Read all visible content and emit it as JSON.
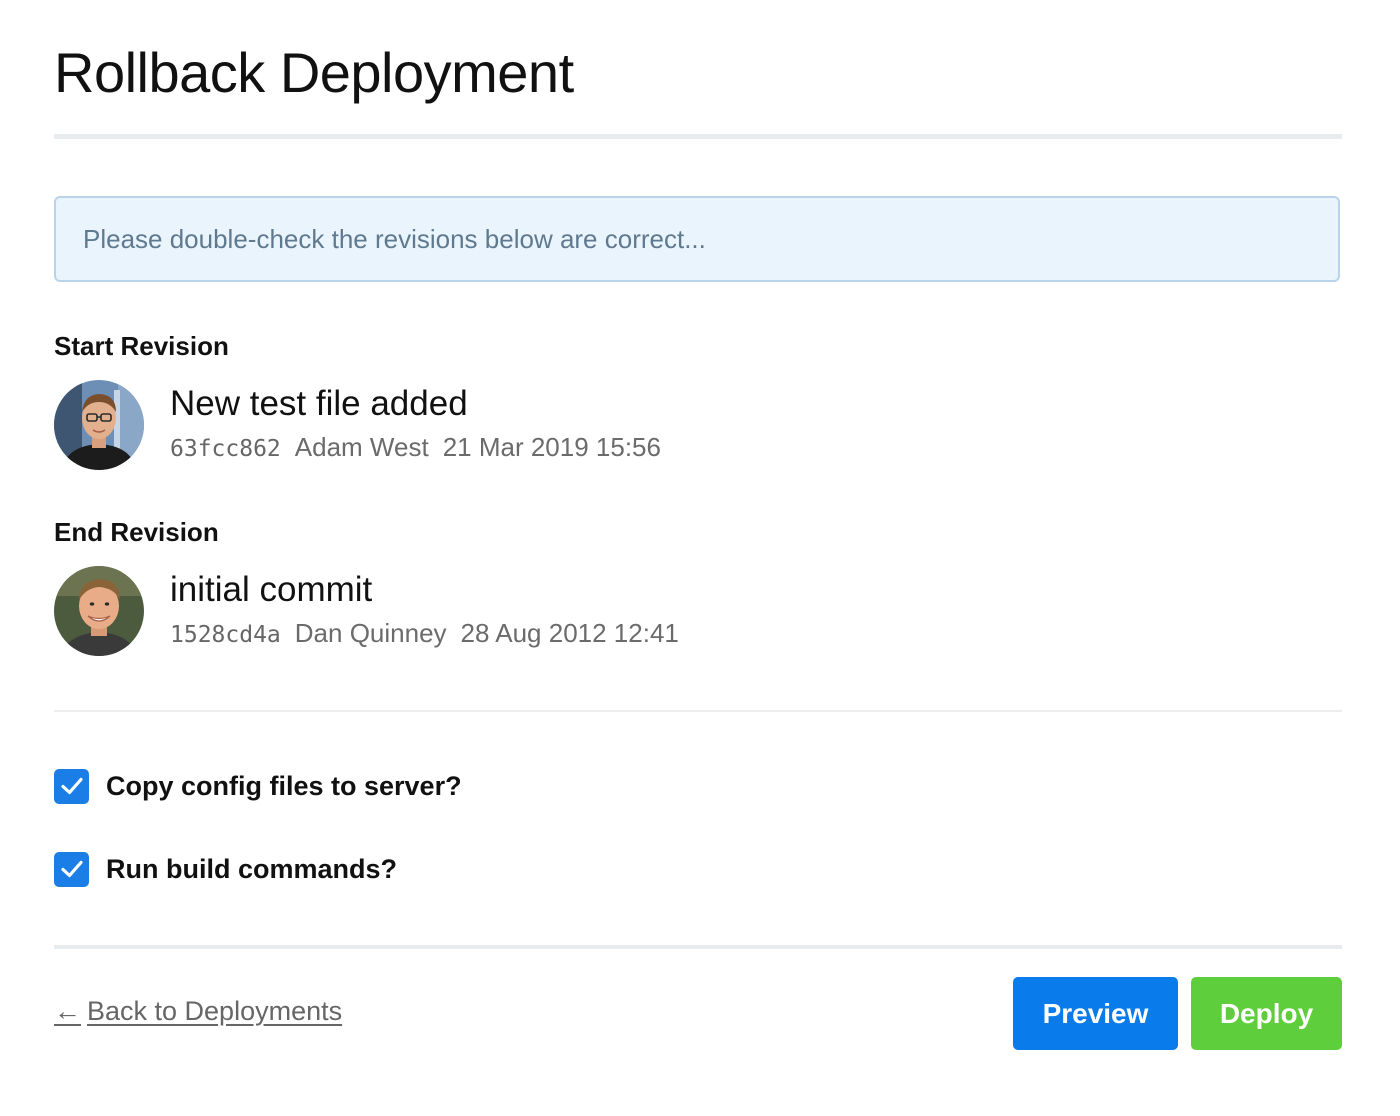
{
  "page": {
    "title": "Rollback Deployment"
  },
  "notice": {
    "text": "Please double-check the revisions below are correct..."
  },
  "start_revision": {
    "label": "Start Revision",
    "message": "New test file added",
    "hash": "63fcc862",
    "author": "Adam West",
    "date": "21 Mar 2019 15:56",
    "avatar_icon": "user-avatar-glasses"
  },
  "end_revision": {
    "label": "End Revision",
    "message": "initial commit",
    "hash": "1528cd4a",
    "author": "Dan Quinney",
    "date": "28 Aug 2012 12:41",
    "avatar_icon": "user-avatar"
  },
  "options": [
    {
      "label": "Copy config files to server?",
      "checked": true
    },
    {
      "label": "Run build commands?",
      "checked": true
    }
  ],
  "footer": {
    "back_arrow": "←",
    "back_label": "Back to Deployments",
    "preview_label": "Preview",
    "deploy_label": "Deploy"
  },
  "colors": {
    "primary": "#0a7bea",
    "success": "#5fce3c",
    "checkbox": "#1a7ee6",
    "notice_bg": "#eaf4fc",
    "notice_border": "#b9d4ea"
  }
}
